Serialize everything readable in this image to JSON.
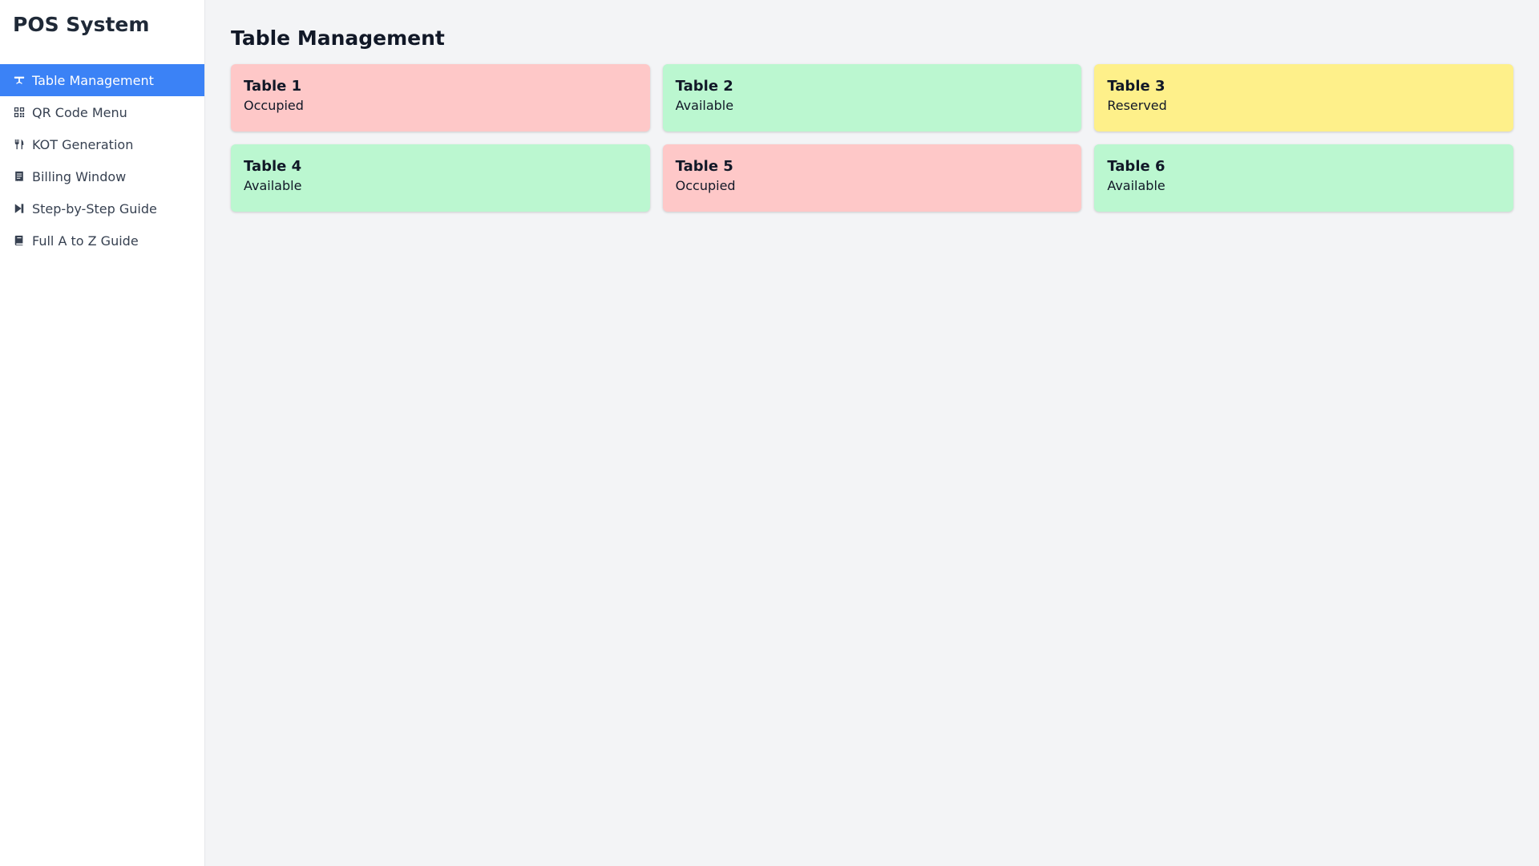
{
  "app": {
    "title": "POS System"
  },
  "sidebar": {
    "items": [
      {
        "label": "Table Management",
        "icon": "table-icon",
        "active": true
      },
      {
        "label": "QR Code Menu",
        "icon": "qr-code-icon",
        "active": false
      },
      {
        "label": "KOT Generation",
        "icon": "utensils-icon",
        "active": false
      },
      {
        "label": "Billing Window",
        "icon": "receipt-icon",
        "active": false
      },
      {
        "label": "Step-by-Step Guide",
        "icon": "step-forward-icon",
        "active": false
      },
      {
        "label": "Full A to Z Guide",
        "icon": "book-icon",
        "active": false
      }
    ]
  },
  "main": {
    "title": "Table Management",
    "tables": [
      {
        "name": "Table 1",
        "status": "Occupied"
      },
      {
        "name": "Table 2",
        "status": "Available"
      },
      {
        "name": "Table 3",
        "status": "Reserved"
      },
      {
        "name": "Table 4",
        "status": "Available"
      },
      {
        "name": "Table 5",
        "status": "Occupied"
      },
      {
        "name": "Table 6",
        "status": "Available"
      }
    ]
  },
  "colors": {
    "accent": "#3b82f6",
    "occupied": "#fec8c8",
    "available": "#bbf7d0",
    "reserved": "#fef08a"
  }
}
